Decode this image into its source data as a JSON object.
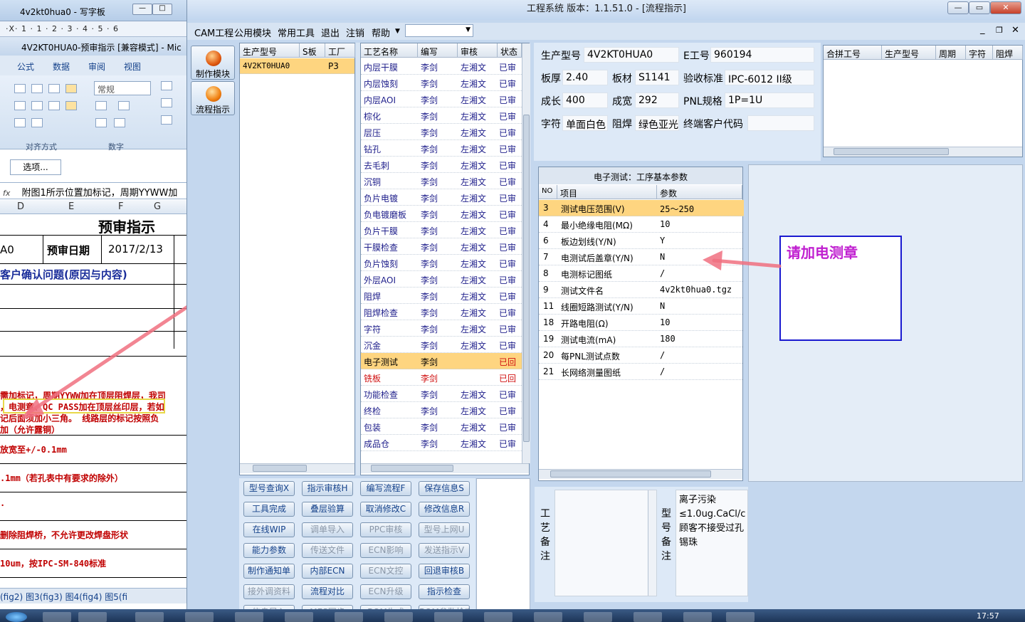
{
  "bg_window": {
    "title": "4v2kt0hua0 - 写字板",
    "ruler": "·X· 1 · 1 · 2 · 3 · 4 · 5 · 6",
    "doc_title": "4V2KT0HUA0-预审指示 [兼容模式] - Mic",
    "ribbon_tabs": [
      "公式",
      "数据",
      "审阅",
      "视图"
    ],
    "ribbon_number_format": "常规",
    "ribbon_groups": [
      "对齐方式",
      "数字"
    ],
    "options_button": "选项...",
    "fx": "fx",
    "formula": "附图1所示位置加标记，周期YYWW加",
    "col_headers": [
      "D",
      "E",
      "F",
      "G"
    ],
    "sheet_title": "预审指示",
    "cell_a0": "A0",
    "review_date_label": "预审日期",
    "review_date": "2017/2/13",
    "confirm_issue": "客户确认问题(原因与内容)",
    "red_lines": [
      "需加标记，周期YYWW加在顶层阻焊层，我司",
      "，电测章、QC PASS加在顶层丝印层，若如",
      "记后面须加小三角。 线路层的标记按照负",
      "加（允许露铜）",
      "放宽至+/-0.1mm",
      ".1mm（若孔表中有要求的除外）",
      "·",
      "删除阻焊桥，不允许更改焊盘形状",
      "10um，按IPC-SM-840标准"
    ],
    "sheet_tabs": "(fig2) 图3(fig3) 图4(fig4) 图5(fi"
  },
  "main_window": {
    "title": "工程系统   版本：1.1.51.0 - [流程指示]",
    "menu": [
      "CAM工程",
      "公用模块",
      "常用工具",
      "退出",
      "注销",
      "帮助"
    ],
    "left_buttons": [
      "制作模块",
      "流程指示"
    ],
    "model_table": {
      "headers": [
        "生产型号",
        "S板",
        "工厂"
      ],
      "rows": [
        [
          "4V2KT0HUA0",
          "",
          "P3"
        ]
      ]
    },
    "process_table": {
      "headers": [
        "工艺名称",
        "编写",
        "审核",
        "状态"
      ],
      "rows": [
        [
          "内层干膜",
          "李剑",
          "左湘文",
          "已审"
        ],
        [
          "内层蚀刻",
          "李剑",
          "左湘文",
          "已审"
        ],
        [
          "内层AOI",
          "李剑",
          "左湘文",
          "已审"
        ],
        [
          "棕化",
          "李剑",
          "左湘文",
          "已审"
        ],
        [
          "层压",
          "李剑",
          "左湘文",
          "已审"
        ],
        [
          "钻孔",
          "李剑",
          "左湘文",
          "已审"
        ],
        [
          "去毛刺",
          "李剑",
          "左湘文",
          "已审"
        ],
        [
          "沉铜",
          "李剑",
          "左湘文",
          "已审"
        ],
        [
          "负片电镀",
          "李剑",
          "左湘文",
          "已审"
        ],
        [
          "负电镀磨板",
          "李剑",
          "左湘文",
          "已审"
        ],
        [
          "负片干膜",
          "李剑",
          "左湘文",
          "已审"
        ],
        [
          "干膜检查",
          "李剑",
          "左湘文",
          "已审"
        ],
        [
          "负片蚀刻",
          "李剑",
          "左湘文",
          "已审"
        ],
        [
          "外层AOI",
          "李剑",
          "左湘文",
          "已审"
        ],
        [
          "阻焊",
          "李剑",
          "左湘文",
          "已审"
        ],
        [
          "阻焊检查",
          "李剑",
          "左湘文",
          "已审"
        ],
        [
          "字符",
          "李剑",
          "左湘文",
          "已审"
        ],
        [
          "沉金",
          "李剑",
          "左湘文",
          "已审"
        ],
        [
          "电子测试",
          "李剑",
          "",
          "已回"
        ],
        [
          "铣板",
          "李剑",
          "",
          "已回"
        ],
        [
          "功能检查",
          "李剑",
          "左湘文",
          "已审"
        ],
        [
          "终检",
          "李剑",
          "左湘文",
          "已审"
        ],
        [
          "包装",
          "李剑",
          "左湘文",
          "已审"
        ],
        [
          "成品仓",
          "李剑",
          "左湘文",
          "已审"
        ]
      ]
    },
    "info": {
      "model_label": "生产型号",
      "model": "4V2KT0HUA0",
      "e_label": "E工号",
      "e_no": "960194",
      "thick_label": "板厚",
      "thick": "2.40",
      "mat_label": "板材",
      "mat": "S1141",
      "std_label": "验收标准",
      "std": "IPC-6012 II级",
      "len_label": "成长",
      "len": "400",
      "wid_label": "成宽",
      "wid": "292",
      "pnl_label": "PNL规格",
      "pnl": "1P=1U",
      "char_label": "字符",
      "char": "单面白色",
      "mask_label": "阻焊",
      "mask": "绿色亚光",
      "cust_label": "终端客户代码",
      "cust": ""
    },
    "merge_table": {
      "headers": [
        "合拼工号",
        "生产型号",
        "周期",
        "字符",
        "阻焊"
      ]
    },
    "params": {
      "title": "电子测试：工序基本参数",
      "headers": [
        "NO",
        "项目",
        "参数"
      ],
      "rows": [
        [
          "3",
          "测试电压范围(V)",
          "25～250"
        ],
        [
          "4",
          "最小绝缘电阻(MΩ)",
          "10"
        ],
        [
          "6",
          "板边划线(Y/N)",
          "Y"
        ],
        [
          "7",
          "电测试后盖章(Y/N)",
          "N"
        ],
        [
          "8",
          "电测标记图纸",
          "/"
        ],
        [
          "9",
          "测试文件名",
          "4v2kt0hua0.tgz"
        ],
        [
          "11",
          "线圈短路测试(Y/N)",
          "N"
        ],
        [
          "18",
          "开路电阻(Ω)",
          "10"
        ],
        [
          "19",
          "测试电流(mA)",
          "180"
        ],
        [
          "20",
          "每PNL测试点数",
          "/"
        ],
        [
          "21",
          "长网络测量图纸",
          "/"
        ]
      ]
    },
    "annotation": "请加电测章",
    "buttons": [
      [
        "型号查询X",
        "指示审核H",
        "编写流程F",
        "保存信息S"
      ],
      [
        "工具完成",
        "叠层验算",
        "取消修改C",
        "修改信息R"
      ],
      [
        "在线WIP",
        "调单导入",
        "PPC审核",
        "型号上网U"
      ],
      [
        "能力参数",
        "传送文件",
        "ECN影响",
        "发送指示V"
      ],
      [
        "制作通知单",
        "内部ECN",
        "ECN文控",
        "回退审核B"
      ],
      [
        "接外调资料",
        "流程对比",
        "ECN升级",
        "指示检查"
      ],
      [
        "信息导入",
        "MES同步",
        "BOM生成",
        "BOM参数检查"
      ]
    ],
    "process_note_label": "工艺备注",
    "model_note_label": "型号备注",
    "model_note": [
      "离子污染",
      "≤1.0ug.CaCl/c",
      "顾客不接受过孔",
      "锡珠"
    ],
    "clock": "17:57"
  }
}
